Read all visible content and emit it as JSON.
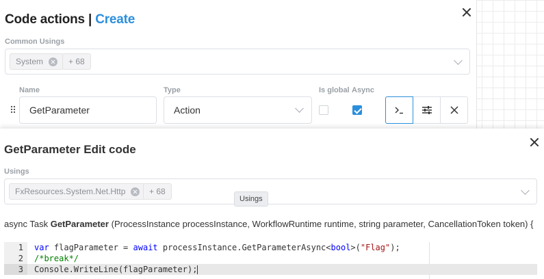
{
  "back_panel": {
    "title": "Code actions",
    "separator": "|",
    "title_link": "Create",
    "common_usings_label": "Common Usings",
    "common_usings_tag": "System",
    "common_usings_more": "+ 68",
    "name_label": "Name",
    "type_label": "Type",
    "is_global_label": "Is global",
    "async_label": "Async",
    "name_value": "GetParameter",
    "type_value": "Action",
    "is_global_checked": false,
    "async_checked": true,
    "run_button_icon": "terminal-icon",
    "settings_button_icon": "sliders-icon",
    "delete_button_icon": "close-icon"
  },
  "front_panel": {
    "title": "GetParameter Edit code",
    "usings_label": "Usings",
    "usings_tag": "FxResources.System.Net.Http",
    "usings_more": "+ 68",
    "tooltip": "Usings",
    "signature_prefix": "async Task",
    "signature_name": "GetParameter",
    "signature_params": "(ProcessInstance processInstance, WorkflowRuntime runtime, string parameter, CancellationToken token) {",
    "code_lines": [
      {
        "num": "1",
        "text": "var flagParameter = await processInstance.GetParameterAsync<bool>(\"Flag\");"
      },
      {
        "num": "2",
        "text": "/*break*/"
      },
      {
        "num": "3",
        "text": "Console.WriteLine(flagParameter);"
      }
    ]
  },
  "colors": {
    "accent": "#2b8fdc",
    "keyword": "#0000ff",
    "string": "#a31515",
    "comment": "#008000"
  }
}
